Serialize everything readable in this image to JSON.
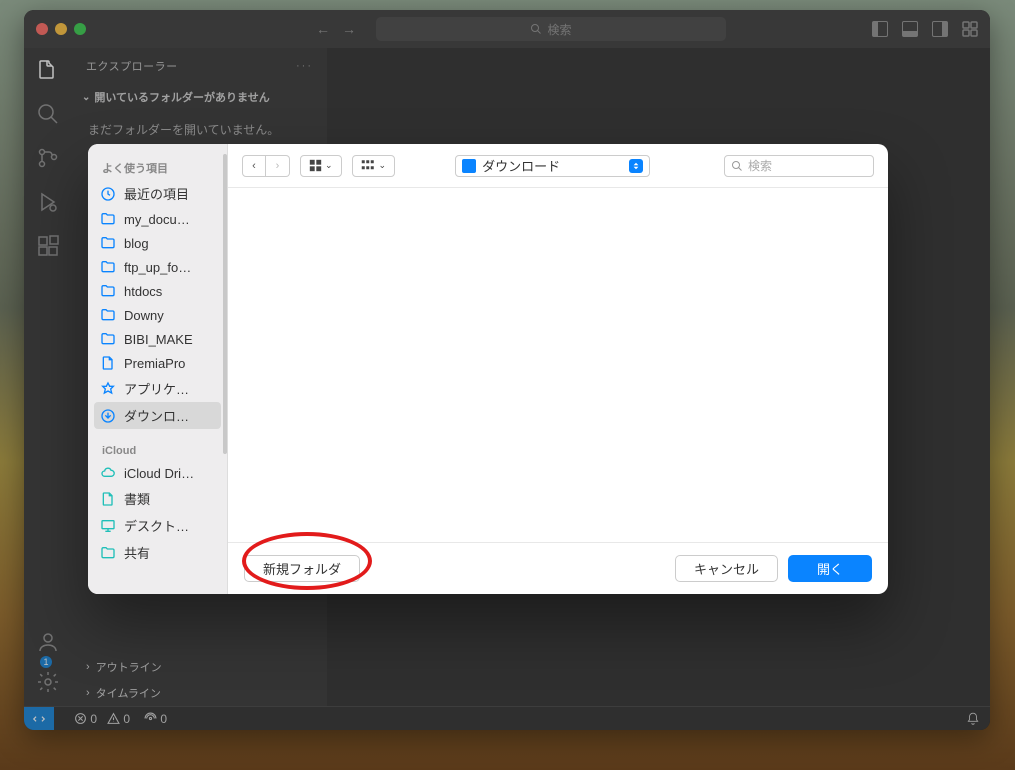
{
  "vscode": {
    "titlebar": {
      "search_placeholder": "検索"
    },
    "sidebar": {
      "title": "エクスプローラー",
      "section": "開いているフォルダーがありません",
      "empty_text": "まだフォルダーを開いていません。",
      "outline": "アウトライン",
      "timeline": "タイムライン"
    },
    "status": {
      "errors": "0",
      "warnings": "0",
      "radio": "0",
      "account_badge": "1"
    }
  },
  "dialog": {
    "sidebar": {
      "favorites_header": "よく使う項目",
      "items": [
        {
          "label": "最近の項目",
          "icon": "clock"
        },
        {
          "label": "my_docu…",
          "icon": "folder"
        },
        {
          "label": "blog",
          "icon": "folder"
        },
        {
          "label": "ftp_up_fo…",
          "icon": "folder"
        },
        {
          "label": "htdocs",
          "icon": "folder"
        },
        {
          "label": "Downy",
          "icon": "folder"
        },
        {
          "label": "BIBI_MAKE",
          "icon": "folder"
        },
        {
          "label": "PremiaPro",
          "icon": "file"
        },
        {
          "label": "アプリケ…",
          "icon": "app"
        },
        {
          "label": "ダウンロ…",
          "icon": "download",
          "selected": true
        }
      ],
      "icloud_header": "iCloud",
      "icloud_items": [
        {
          "label": "iCloud Dri…",
          "icon": "cloud"
        },
        {
          "label": "書類",
          "icon": "file"
        },
        {
          "label": "デスクト…",
          "icon": "desktop"
        },
        {
          "label": "共有",
          "icon": "folder"
        }
      ]
    },
    "location": "ダウンロード",
    "search_placeholder": "検索",
    "footer": {
      "new_folder": "新規フォルダ",
      "cancel": "キャンセル",
      "open": "開く"
    }
  }
}
